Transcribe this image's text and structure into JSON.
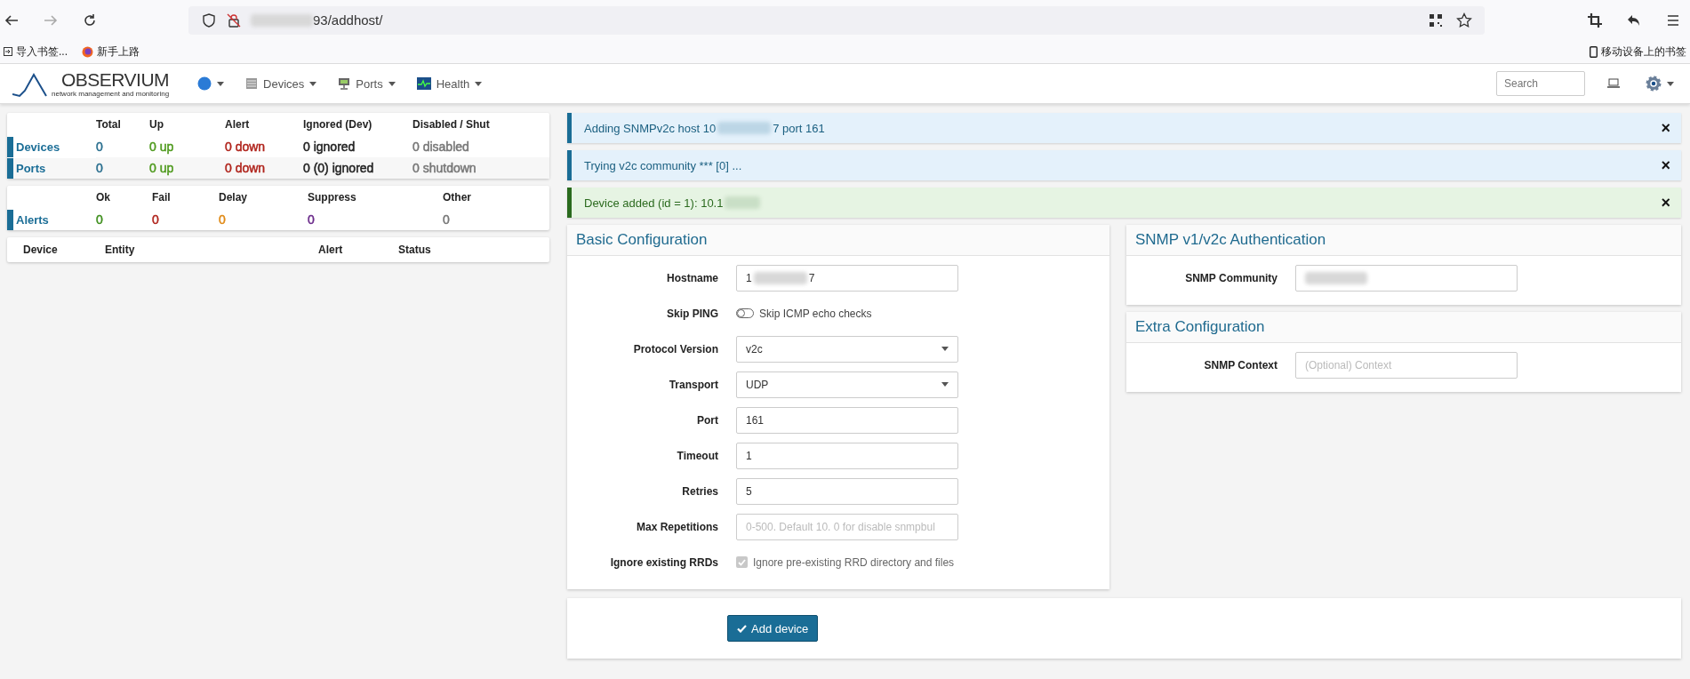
{
  "browser": {
    "url": "93/addhost/",
    "bookmarks": [
      "导入书签...",
      "新手上路"
    ],
    "mobile_bookmarks": "移动设备上的书签"
  },
  "navbar": {
    "brand": "OBSERVIUM",
    "tagline": "network management and monitoring",
    "menus": [
      "Devices",
      "Ports",
      "Health"
    ],
    "search_placeholder": "Search"
  },
  "status_table": {
    "columns": [
      "Total",
      "Up",
      "Alert",
      "Ignored (Dev)",
      "Disabled / Shut"
    ],
    "rows": [
      {
        "name": "Devices",
        "cells": [
          {
            "text": "0",
            "color": "#2a6f8f"
          },
          {
            "text": "0 up",
            "color": "#4f9a1e"
          },
          {
            "text": "0 down",
            "color": "#b0241c"
          },
          {
            "text": "0 ignored",
            "color": "#222222"
          },
          {
            "text": "0 disabled",
            "color": "#777777"
          }
        ]
      },
      {
        "name": "Ports",
        "cells": [
          {
            "text": "0",
            "color": "#2a6f8f"
          },
          {
            "text": "0 up",
            "color": "#4f9a1e"
          },
          {
            "text": "0 down",
            "color": "#b0241c"
          },
          {
            "text": "0 (0) ignored",
            "color": "#222222"
          },
          {
            "text": "0 shutdown",
            "color": "#777777"
          }
        ]
      }
    ]
  },
  "alerts_table": {
    "columns": [
      "Ok",
      "Fail",
      "Delay",
      "Suppress",
      "Other"
    ],
    "rows": [
      {
        "name": "Alerts",
        "cells": [
          {
            "text": "0",
            "color": "#3f8f1e"
          },
          {
            "text": "0",
            "color": "#b0241c"
          },
          {
            "text": "0",
            "color": "#e08a16"
          },
          {
            "text": "0",
            "color": "#6a2a8a"
          },
          {
            "text": "0",
            "color": "#777777"
          }
        ]
      }
    ]
  },
  "alert_list": {
    "columns": [
      "Device",
      "Entity",
      "Alert",
      "Status"
    ]
  },
  "messages": [
    {
      "kind": "info",
      "parts": [
        "Adding SNMPv2c host 10",
        "7 port 161"
      ],
      "close": "×"
    },
    {
      "kind": "info",
      "parts": [
        "Trying v2c community *** [0] ..."
      ],
      "close": "×"
    },
    {
      "kind": "success",
      "parts": [
        "Device added (id = 1): 10.1"
      ],
      "close": "×"
    }
  ],
  "basic_configuration": {
    "title": "Basic Configuration",
    "fields": [
      {
        "kind": "text",
        "label": "Hostname",
        "parts": [
          "1",
          "7"
        ]
      },
      {
        "kind": "toggle",
        "label": "Skip PING",
        "text": "Skip ICMP echo checks",
        "on": false
      },
      {
        "kind": "select",
        "label": "Protocol Version",
        "value": "v2c"
      },
      {
        "kind": "select",
        "label": "Transport",
        "value": "UDP"
      },
      {
        "kind": "text",
        "label": "Port",
        "parts": [
          "161"
        ]
      },
      {
        "kind": "text",
        "label": "Timeout",
        "parts": [
          "1"
        ]
      },
      {
        "kind": "text",
        "label": "Retries",
        "parts": [
          "5"
        ]
      },
      {
        "kind": "placeholder",
        "label": "Max Repetitions",
        "placeholder": "0-500. Default 10. 0 for disable snmpbul"
      },
      {
        "kind": "checkbox",
        "label": "Ignore existing RRDs",
        "text": "Ignore pre-existing RRD directory and files",
        "checked": true,
        "disabled": true
      }
    ]
  },
  "snmp_authentication": {
    "title": "SNMP v1/v2c Authentication",
    "fields": [
      {
        "kind": "redacted",
        "label": "SNMP Community"
      }
    ]
  },
  "extra_configuration": {
    "title": "Extra Configuration",
    "fields": [
      {
        "kind": "placeholder",
        "label": "SNMP Context",
        "placeholder": "(Optional) Context"
      }
    ]
  },
  "submit": {
    "label": "Add device"
  }
}
